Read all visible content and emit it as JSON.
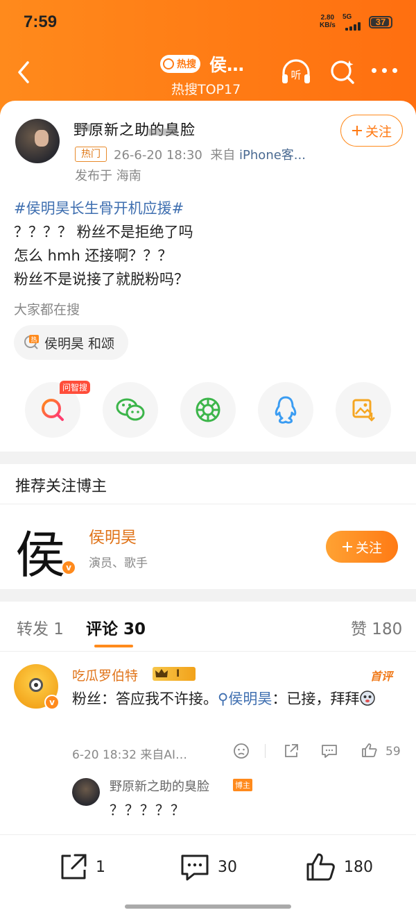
{
  "status": {
    "time": "7:59",
    "speed_value": "2.80",
    "speed_unit": "KB/s",
    "network": "5G",
    "battery": "37"
  },
  "nav": {
    "hot_tag": "热搜",
    "title": "侯…",
    "subtitle": "热搜TOP17",
    "listen_label": "听"
  },
  "post": {
    "username": "野原新之助的臭脸",
    "badge": "热门",
    "date": "26-6-20 18:30",
    "source_prefix": "来自",
    "source_device": "iPhone客...",
    "location": "发布于 海南",
    "follow_label": "关注",
    "topic": "#侯明昊长生骨开机应援#",
    "lines": [
      "？？？？ 粉丝不是拒绝了吗",
      "怎么 hmh 还接啊？？？",
      "粉丝不是说接了就脱粉吗？"
    ],
    "search_label": "大家都在搜",
    "search_chip": "侯明昊 和颂",
    "search_chip_icon_text": "热"
  },
  "share": {
    "ai_badge": "问智搜"
  },
  "recommend": {
    "title": "推荐关注博主",
    "avatar_char": "侯",
    "name": "侯明昊",
    "desc": "演员、歌手",
    "follow_label": "关注"
  },
  "comments": {
    "tabs": {
      "repost": "转发 1",
      "comment": "评论 30",
      "like": "赞 180"
    },
    "item": {
      "name": "吃瓜罗伯特",
      "level": "I",
      "tag": "首评",
      "text_before": "粉丝：答应我不许接。",
      "mention": "侯明昊",
      "text_after": "：已接，拜拜",
      "meta": "6-20 18:32  来自AI…",
      "likes": "59"
    },
    "reply": {
      "name": "野原新之助的臭脸",
      "badge": "博主",
      "text": "？？？？？"
    }
  },
  "bottom": {
    "repost": "1",
    "comment": "30",
    "like": "180"
  },
  "colors": {
    "accent": "#ff7a14",
    "link": "#3f6fb0"
  }
}
